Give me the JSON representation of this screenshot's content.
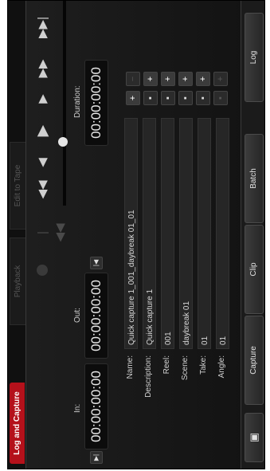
{
  "tabs": {
    "log_and_capture": "Log and Capture",
    "playback": "Playback",
    "edit_to_tape": "Edit to Tape"
  },
  "timecode": {
    "in_label": "In:",
    "in_value": "00:00:00:00",
    "out_label": "Out:",
    "out_value": "00:00:00:00",
    "duration_label": "Duration:",
    "duration_value": "00:00:00:00"
  },
  "fields": {
    "name_label": "Name:",
    "name_value": "Quick capture 1_001_daybreak 01_01",
    "description_label": "Description:",
    "description_value": "Quick capture 1",
    "reel_label": "Reel:",
    "reel_value": "001",
    "scene_label": "Scene:",
    "scene_value": "daybreak 01",
    "take_label": "Take:",
    "take_value": "01",
    "angle_label": "Angle:",
    "angle_value": "01"
  },
  "buttons": {
    "capture": "Capture",
    "clip": "Clip",
    "batch": "Batch",
    "log": "Log"
  },
  "icons": {
    "camera": "camera-icon",
    "mark_in": "mark-in-icon",
    "mark_out": "mark-out-icon",
    "play": "play-icon",
    "rewind": "rewind-icon",
    "fast_forward": "fast-forward-icon"
  },
  "colors": {
    "accent_tab": "#b4111b",
    "background": "#161616"
  }
}
